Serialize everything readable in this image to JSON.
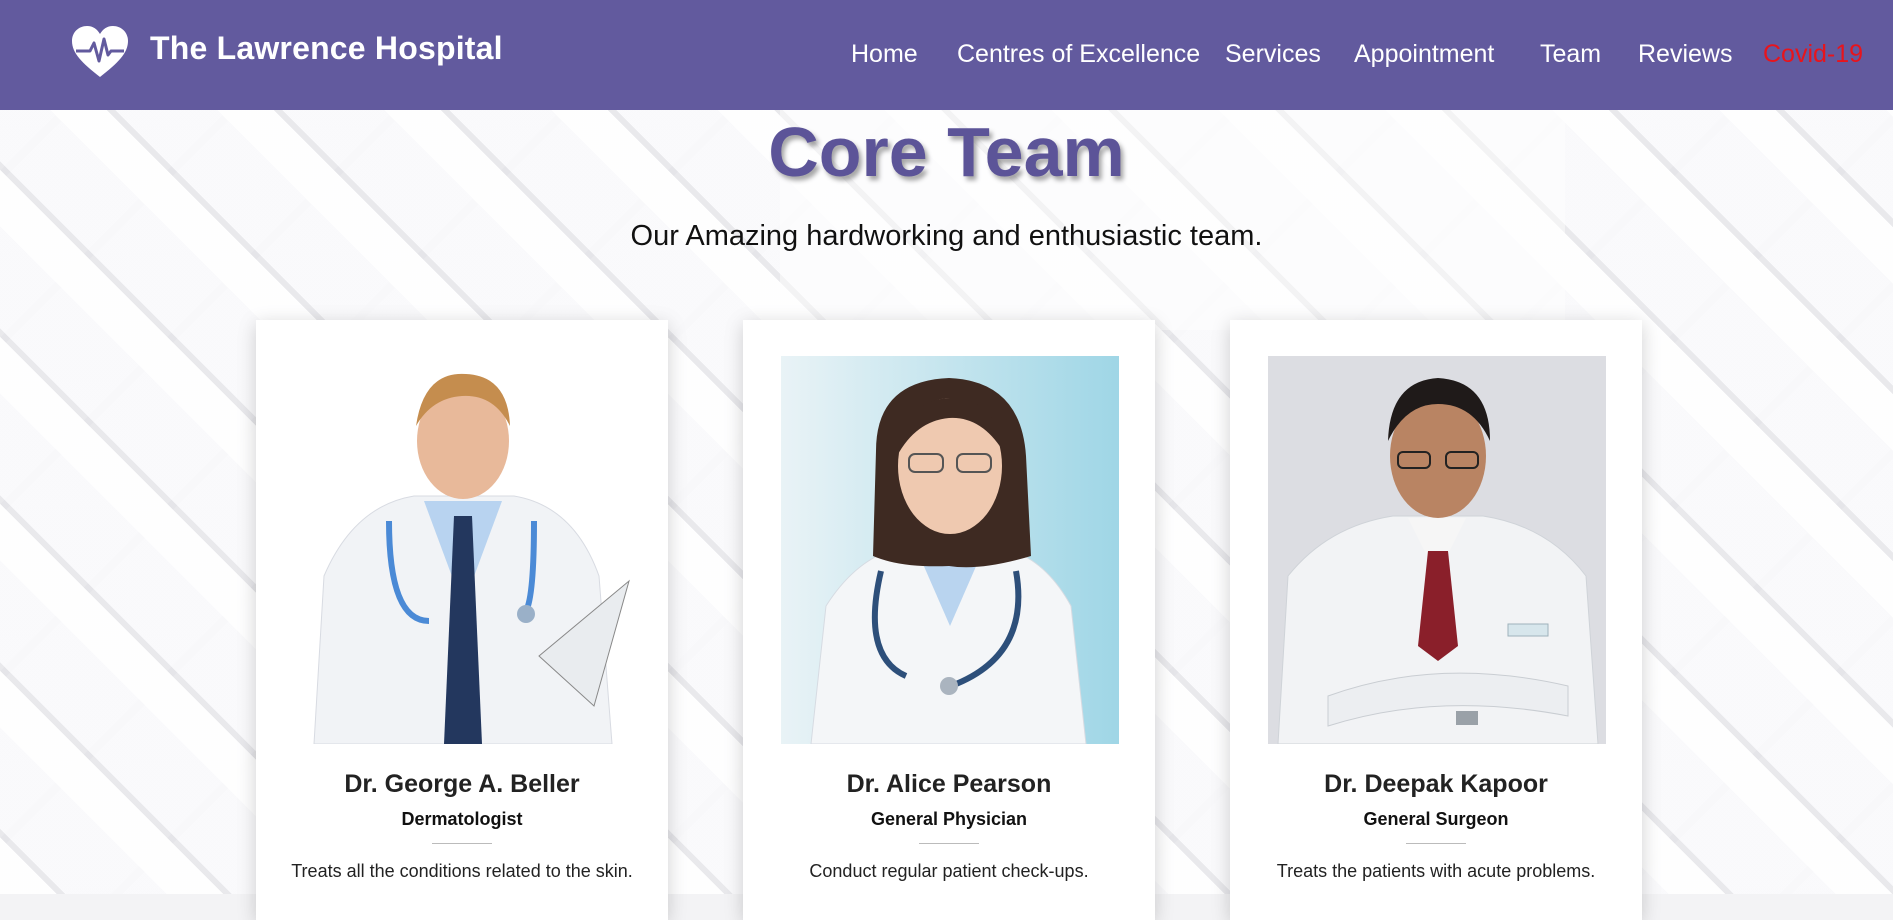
{
  "brand": {
    "name": "The Lawrence Hospital",
    "icon": "heart-pulse-icon"
  },
  "nav": {
    "items": [
      {
        "label": "Home"
      },
      {
        "label": "Centres of Excellence"
      },
      {
        "label": "Services"
      },
      {
        "label": "Appointment"
      },
      {
        "label": "Team"
      },
      {
        "label": "Reviews"
      },
      {
        "label": "Covid-19"
      }
    ]
  },
  "section": {
    "title": "Core Team",
    "subtitle": "Our Amazing hardworking and enthusiastic team."
  },
  "team": [
    {
      "name": "Dr. George A. Beller",
      "role": "Dermatologist",
      "description": "Treats all the conditions related to the skin."
    },
    {
      "name": "Dr. Alice Pearson",
      "role": "General Physician",
      "description": "Conduct regular patient check-ups."
    },
    {
      "name": "Dr. Deepak Kapoor",
      "role": "General Surgeon",
      "description": "Treats the patients with acute problems."
    }
  ],
  "colors": {
    "header": "#625a9e",
    "title": "#5c5498",
    "covid": "#e8141c"
  }
}
